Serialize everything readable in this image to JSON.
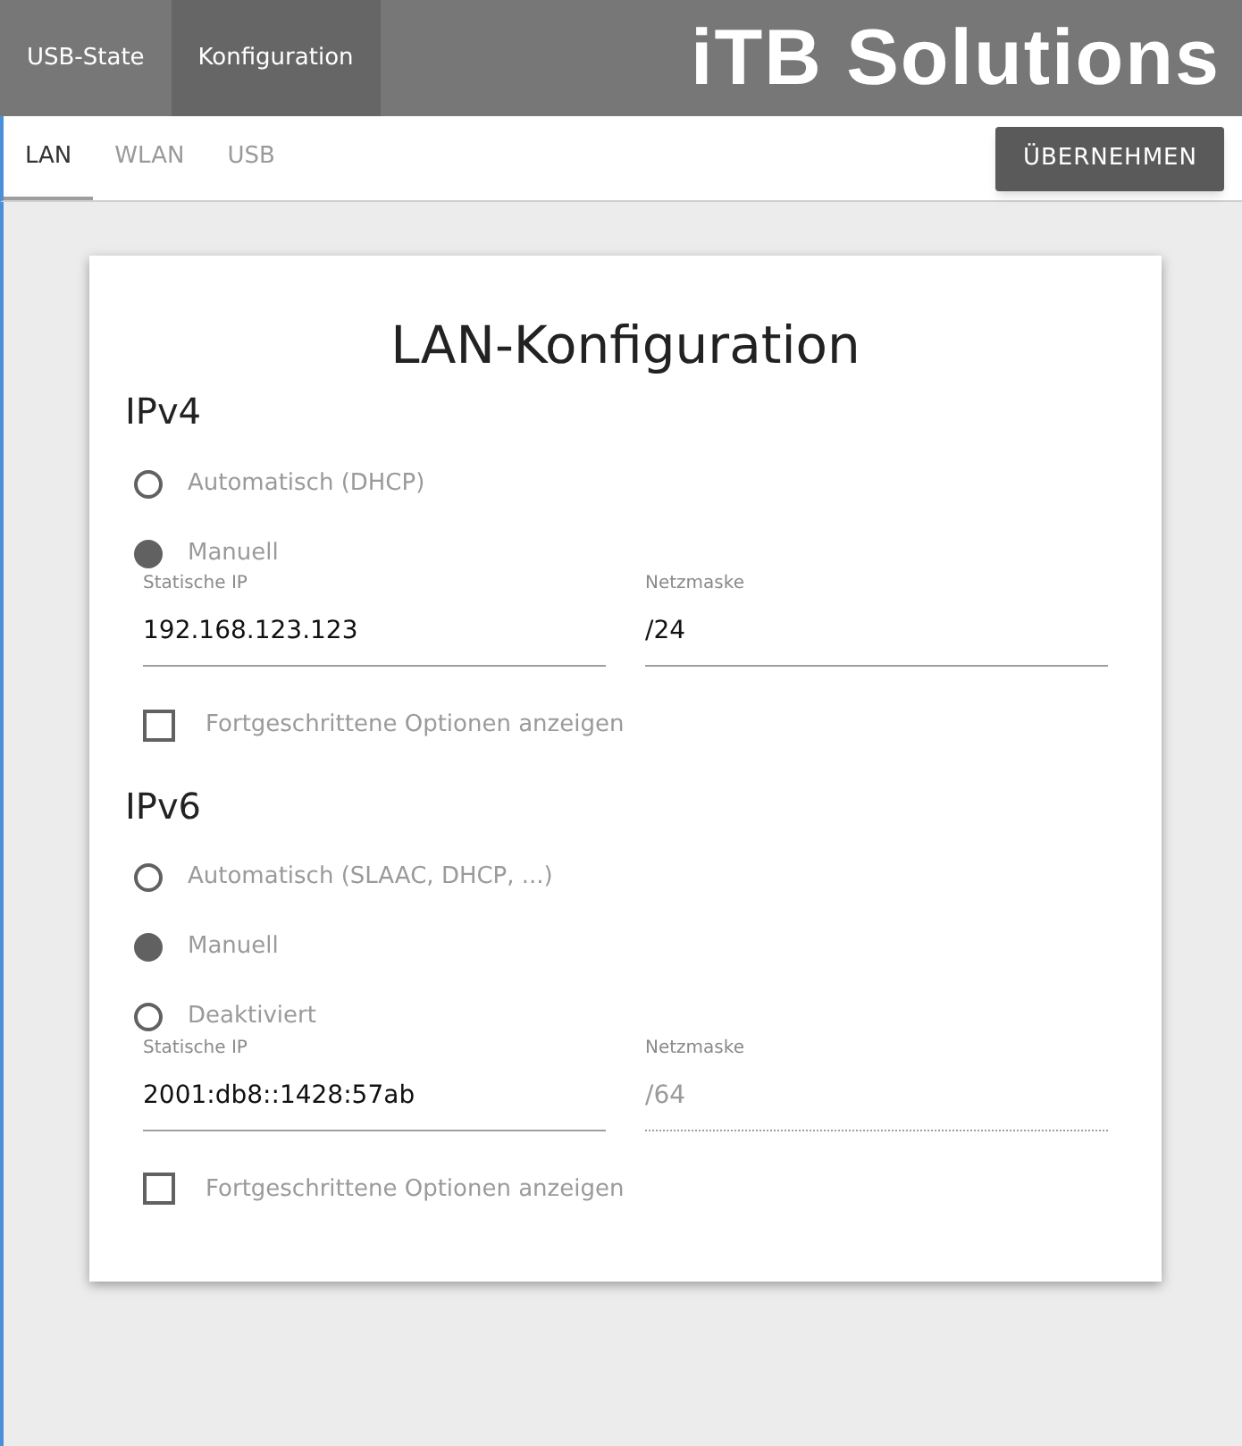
{
  "nav": {
    "tabs": [
      {
        "label": "USB-State",
        "selected": false
      },
      {
        "label": "Konfiguration",
        "selected": true
      }
    ],
    "logo": "iTB Solutions"
  },
  "subtabs": [
    {
      "label": "LAN",
      "selected": true
    },
    {
      "label": "WLAN",
      "selected": false
    },
    {
      "label": "USB",
      "selected": false
    }
  ],
  "apply_button": "ÜBERNEHMEN",
  "card": {
    "title": "LAN-Konfiguration",
    "sections": [
      {
        "heading": "IPv4",
        "options": [
          {
            "label": "Automatisch (DHCP)",
            "selected": false
          },
          {
            "label": "Manuell",
            "selected": true
          }
        ],
        "fields": [
          {
            "label": "Statische IP",
            "value": "192.168.123.123",
            "disabled": false
          },
          {
            "label": "Netzmaske",
            "value": "/24",
            "disabled": false
          }
        ],
        "advanced": {
          "label": "Fortgeschrittene Optionen anzeigen",
          "checked": false
        }
      },
      {
        "heading": "IPv6",
        "options": [
          {
            "label": "Automatisch (SLAAC, DHCP, ...)",
            "selected": false
          },
          {
            "label": "Manuell",
            "selected": true
          },
          {
            "label": "Deaktiviert",
            "selected": false
          }
        ],
        "fields": [
          {
            "label": "Statische IP",
            "value": "2001:db8::1428:57ab",
            "disabled": false
          },
          {
            "label": "Netzmaske",
            "value": "/64",
            "disabled": true
          }
        ],
        "advanced": {
          "label": "Fortgeschrittene Optionen anzeigen",
          "checked": false
        }
      }
    ]
  }
}
